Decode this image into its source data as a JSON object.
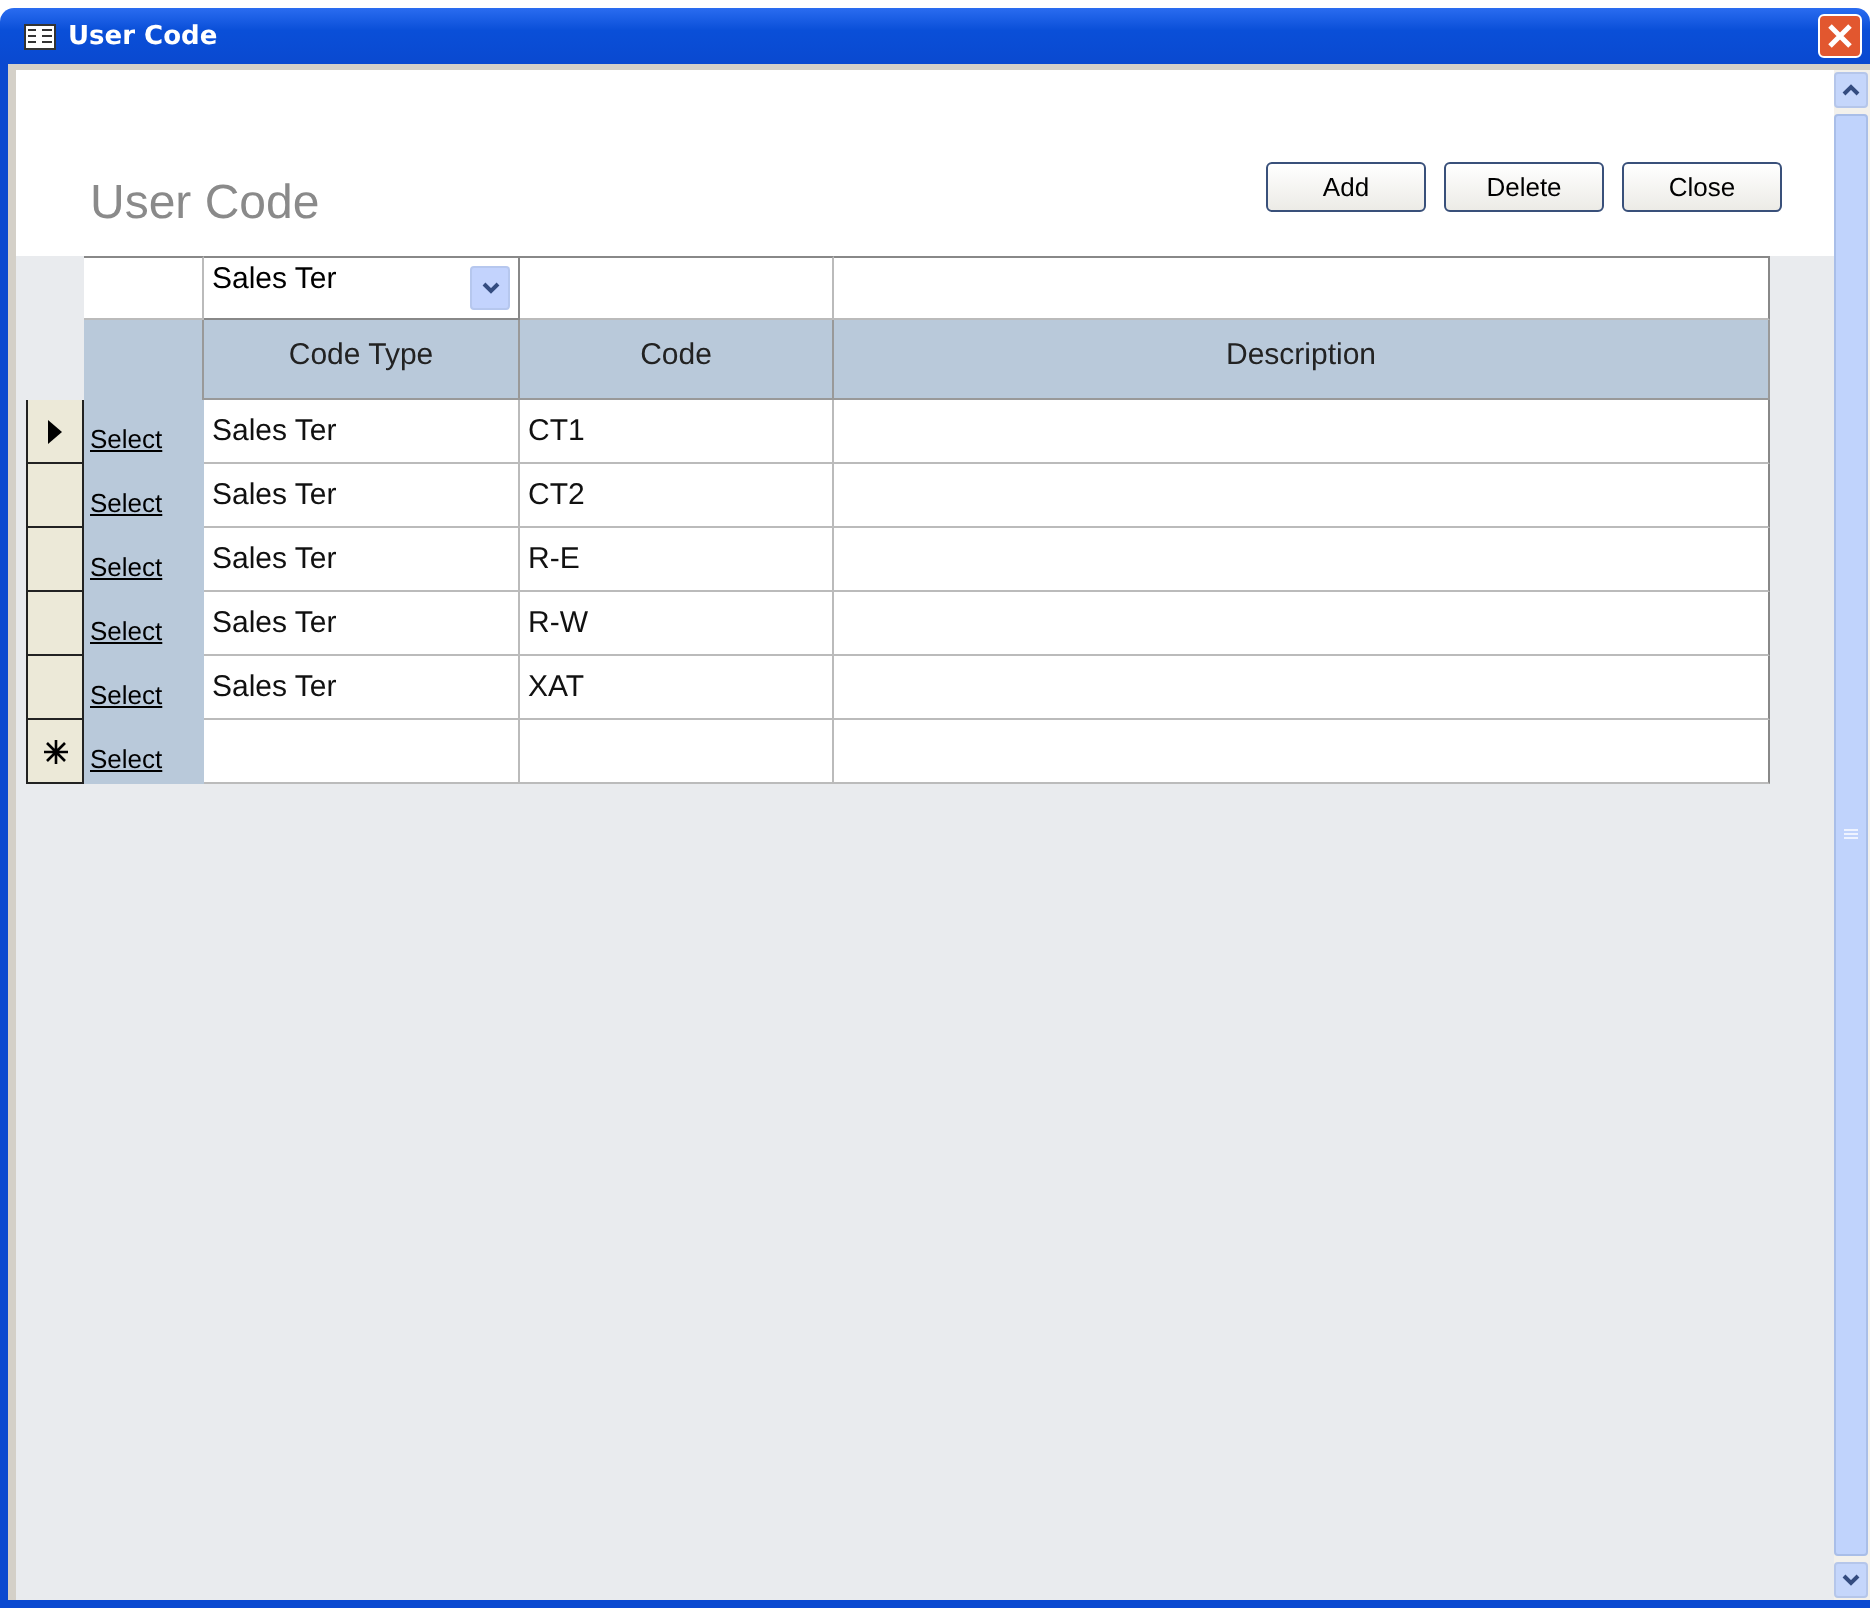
{
  "window": {
    "title": "User Code"
  },
  "form_title": "User Code",
  "buttons": [
    "Add",
    "Delete",
    "Close"
  ],
  "filter": {
    "code_type": "Sales Ter"
  },
  "columns": [
    "Code Type",
    "Code",
    "Description"
  ],
  "rows": [
    {
      "kind": "record",
      "current": true,
      "link": "Select",
      "code_type": "Sales Ter",
      "code": "CT1"
    },
    {
      "kind": "record",
      "current": false,
      "link": "Select",
      "code_type": "Sales Ter",
      "code": "CT2"
    },
    {
      "kind": "record",
      "current": false,
      "link": "Select",
      "code_type": "Sales Ter",
      "code": "R-E"
    },
    {
      "kind": "record",
      "current": false,
      "link": "Select",
      "code_type": "Sales Ter",
      "code": "R-W"
    },
    {
      "kind": "record",
      "current": false,
      "link": "Select",
      "code_type": "Sales Ter",
      "code": "XAT"
    },
    {
      "kind": "new",
      "link": "Select"
    }
  ]
}
